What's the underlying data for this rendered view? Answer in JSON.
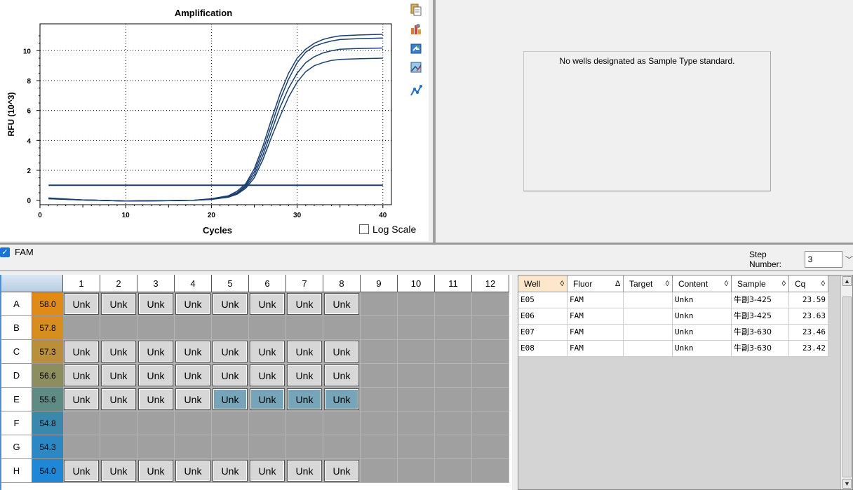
{
  "chart": {
    "title": "Amplification",
    "xlabel": "Cycles",
    "ylabel": "RFU (10^3)",
    "log_scale_label": "Log Scale",
    "log_scale_checked": false
  },
  "chart_data": {
    "type": "line",
    "title": "Amplification",
    "xlabel": "Cycles",
    "ylabel": "RFU (10^3)",
    "xlim": [
      0,
      41
    ],
    "ylim": [
      -0.3,
      11.8
    ],
    "xticks": [
      0,
      10,
      20,
      30,
      40
    ],
    "yticks": [
      0,
      2,
      4,
      6,
      8,
      10
    ],
    "grid": "dotted",
    "line_color": "#1a3f6e",
    "threshold": 1.0,
    "series": [
      {
        "x": [
          1,
          5,
          10,
          15,
          18,
          20,
          22,
          23,
          24,
          25,
          26,
          27,
          28,
          29,
          30,
          31,
          32,
          33,
          34,
          35,
          37,
          40
        ],
        "y": [
          0.15,
          0.02,
          -0.05,
          -0.03,
          0,
          0.1,
          0.3,
          0.6,
          1.1,
          2.1,
          3.6,
          5.4,
          7.1,
          8.5,
          9.5,
          10.1,
          10.5,
          10.75,
          10.9,
          11.0,
          11.05,
          11.1
        ]
      },
      {
        "x": [
          1,
          5,
          10,
          15,
          18,
          20,
          22,
          23,
          24,
          25,
          26,
          27,
          28,
          29,
          30,
          31,
          32,
          33,
          34,
          35,
          37,
          40
        ],
        "y": [
          0.12,
          0.02,
          -0.05,
          -0.03,
          0,
          0.08,
          0.25,
          0.5,
          1.0,
          1.9,
          3.3,
          5.0,
          6.7,
          8.1,
          9.2,
          9.9,
          10.3,
          10.5,
          10.65,
          10.75,
          10.8,
          10.85
        ]
      },
      {
        "x": [
          1,
          5,
          10,
          15,
          18,
          20,
          22,
          23,
          24,
          25,
          26,
          27,
          28,
          29,
          30,
          31,
          32,
          33,
          34,
          35,
          37,
          40
        ],
        "y": [
          0.1,
          0.02,
          -0.05,
          -0.03,
          0,
          0.06,
          0.22,
          0.45,
          0.9,
          1.7,
          3.0,
          4.6,
          6.2,
          7.5,
          8.5,
          9.2,
          9.6,
          9.85,
          10.0,
          10.1,
          10.15,
          10.18
        ]
      },
      {
        "x": [
          1,
          5,
          10,
          15,
          18,
          20,
          22,
          23,
          24,
          25,
          26,
          27,
          28,
          29,
          30,
          31,
          32,
          33,
          34,
          35,
          37,
          40
        ],
        "y": [
          0.1,
          0.02,
          -0.05,
          -0.03,
          0,
          0.05,
          0.2,
          0.4,
          0.8,
          1.5,
          2.7,
          4.2,
          5.6,
          6.9,
          7.9,
          8.6,
          9.0,
          9.2,
          9.35,
          9.42,
          9.46,
          9.5
        ]
      }
    ]
  },
  "standard_panel": {
    "message": "No wells designated as Sample Type standard."
  },
  "fluor_filter": {
    "label": "FAM",
    "checked": true
  },
  "step": {
    "label": "Step Number:",
    "value": "3"
  },
  "plate": {
    "columns": [
      "1",
      "2",
      "3",
      "4",
      "5",
      "6",
      "7",
      "8",
      "9",
      "10",
      "11",
      "12"
    ],
    "rows": [
      {
        "label": "A",
        "temp": "58.0",
        "temp_color": "#e08a18",
        "wells": [
          "Unk",
          "Unk",
          "Unk",
          "Unk",
          "Unk",
          "Unk",
          "Unk",
          "Unk",
          "",
          "",
          "",
          ""
        ]
      },
      {
        "label": "B",
        "temp": "57.8",
        "temp_color": "#d88d1f",
        "wells": [
          "",
          "",
          "",
          "",
          "",
          "",
          "",
          "",
          "",
          "",
          "",
          ""
        ]
      },
      {
        "label": "C",
        "temp": "57.3",
        "temp_color": "#b98f3c",
        "wells": [
          "Unk",
          "Unk",
          "Unk",
          "Unk",
          "Unk",
          "Unk",
          "Unk",
          "Unk",
          "",
          "",
          "",
          ""
        ]
      },
      {
        "label": "D",
        "temp": "56.6",
        "temp_color": "#8d8e60",
        "wells": [
          "Unk",
          "Unk",
          "Unk",
          "Unk",
          "Unk",
          "Unk",
          "Unk",
          "Unk",
          "",
          "",
          "",
          ""
        ]
      },
      {
        "label": "E",
        "temp": "55.6",
        "temp_color": "#5e8c85",
        "wells": [
          "Unk",
          "Unk",
          "Unk",
          "Unk",
          "Unk",
          "Unk",
          "Unk",
          "Unk",
          "",
          "",
          "",
          ""
        ]
      },
      {
        "label": "F",
        "temp": "54.8",
        "temp_color": "#3a89ad",
        "wells": [
          "",
          "",
          "",
          "",
          "",
          "",
          "",
          "",
          "",
          "",
          "",
          ""
        ]
      },
      {
        "label": "G",
        "temp": "54.3",
        "temp_color": "#2c88c2",
        "wells": [
          "",
          "",
          "",
          "",
          "",
          "",
          "",
          "",
          "",
          "",
          "",
          ""
        ]
      },
      {
        "label": "H",
        "temp": "54.0",
        "temp_color": "#1f87d6",
        "wells": [
          "Unk",
          "Unk",
          "Unk",
          "Unk",
          "Unk",
          "Unk",
          "Unk",
          "Unk",
          "",
          "",
          "",
          ""
        ]
      }
    ],
    "selected": [
      "E5",
      "E6",
      "E7",
      "E8"
    ]
  },
  "results_table": {
    "columns": [
      {
        "label": "Well",
        "sort": "◊"
      },
      {
        "label": "Fluor",
        "sort": "∆"
      },
      {
        "label": "Target",
        "sort": "◊"
      },
      {
        "label": "Content",
        "sort": "◊"
      },
      {
        "label": "Sample",
        "sort": "◊"
      },
      {
        "label": "Cq",
        "sort": "◊"
      }
    ],
    "rows": [
      [
        "E05",
        "FAM",
        "",
        "Unkn",
        "牛副3-425",
        "23.59"
      ],
      [
        "E06",
        "FAM",
        "",
        "Unkn",
        "牛副3-425",
        "23.63"
      ],
      [
        "E07",
        "FAM",
        "",
        "Unkn",
        "牛副3-630",
        "23.46"
      ],
      [
        "E08",
        "FAM",
        "",
        "Unkn",
        "牛副3-630",
        "23.42"
      ]
    ]
  },
  "icons": [
    "copy-icon",
    "settings-icon",
    "export-icon",
    "image-icon",
    "chart-style-icon"
  ]
}
